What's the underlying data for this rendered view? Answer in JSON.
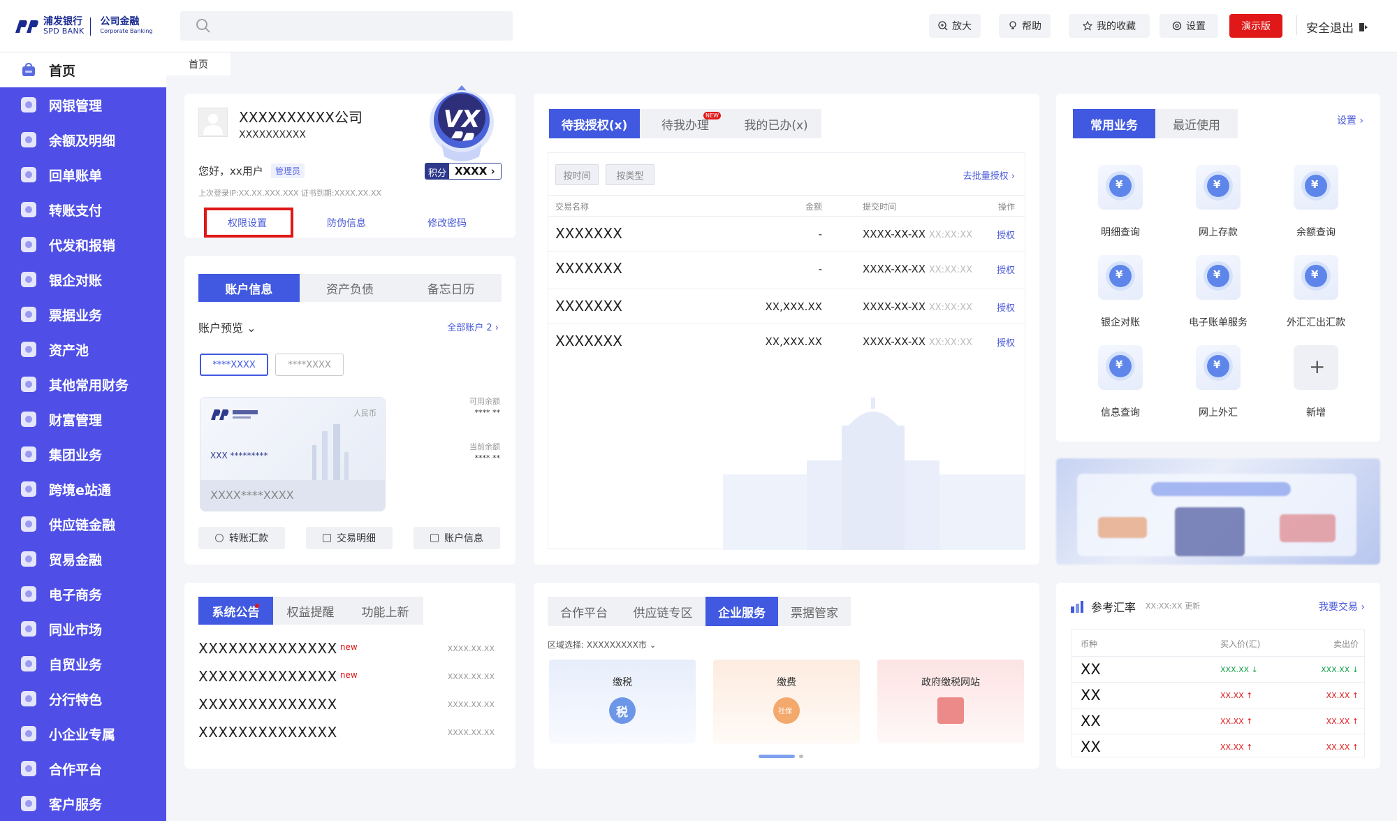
{
  "brand": {
    "cn": "浦发银行",
    "en": "SPD BANK",
    "corp_cn": "公司金融",
    "corp_en": "Corporate Banking"
  },
  "header": {
    "search_placeholder": "",
    "buttons": [
      {
        "label": "放大",
        "icon": "zoom-in-icon"
      },
      {
        "label": "帮助",
        "icon": "bulb-icon"
      },
      {
        "label": "我的收藏",
        "icon": "star-icon"
      },
      {
        "label": "设置",
        "icon": "gear-icon"
      }
    ],
    "demo_label": "演示版",
    "logout_label": "安全退出",
    "demo_color": "#e01818"
  },
  "sidebar": {
    "home_label": "首页",
    "items": [
      "网银管理",
      "余额及明细",
      "回单账单",
      "转账支付",
      "代发和报销",
      "银企对账",
      "票据业务",
      "资产池",
      "其他常用财务",
      "财富管理",
      "集团业务",
      "跨境e站通",
      "供应链金融",
      "贸易金融",
      "电子商务",
      "同业市场",
      "自贸业务",
      "分行特色",
      "小企业专属",
      "合作平台",
      "客户服务"
    ],
    "accent_color": "#4f4fe8"
  },
  "breadcrumb": {
    "label": "首页"
  },
  "company": {
    "name": "XXXXXXXXXX公司",
    "sub": "XXXXXXXXXX",
    "greeting": "您好，xx用户",
    "role": "管理员",
    "login_info": "上次登录IP:XX.XX.XXX.XXX    证书到期:XXXX.XX.XX",
    "links": [
      "权限设置",
      "防伪信息",
      "修改密码"
    ],
    "score_label": "积分",
    "score_value": "XXXX ›",
    "vip_label": "VX"
  },
  "account": {
    "tabs": [
      "账户信息",
      "资产负债",
      "备忘日历"
    ],
    "preview_label": "账户预览 ⌄",
    "all_accounts": "全部账户 2 ›",
    "chips": [
      "****XXXX",
      "****XXXX"
    ],
    "card_currency": "人民币",
    "card_number": "XXX *********",
    "card_footer": "XXXX****XXXX",
    "avail_label": "可用余额",
    "avail_value": "**** **",
    "current_label": "当前余额",
    "current_value": "**** **",
    "actions": [
      "转账汇款",
      "交易明细",
      "账户信息"
    ]
  },
  "approval": {
    "tabs": [
      "待我授权(x)",
      "待我办理",
      "我的已办(x)"
    ],
    "new_badge": "NEW",
    "filters": [
      "按时间",
      "按类型"
    ],
    "batch_link": "去批量授权 ›",
    "columns": [
      "交易名称",
      "金额",
      "提交时间",
      "操作"
    ],
    "rows": [
      {
        "name": "XXXXXXX",
        "amount": "-",
        "date": "XXXX-XX-XX",
        "time": "XX:XX:XX",
        "op": "授权"
      },
      {
        "name": "XXXXXXX",
        "amount": "-",
        "date": "XXXX-XX-XX",
        "time": "XX:XX:XX",
        "op": "授权"
      },
      {
        "name": "XXXXXXX",
        "amount": "XX,XXX.XX",
        "date": "XXXX-XX-XX",
        "time": "XX:XX:XX",
        "op": "授权"
      },
      {
        "name": "XXXXXXX",
        "amount": "XX,XXX.XX",
        "date": "XXXX-XX-XX",
        "time": "XX:XX:XX",
        "op": "授权"
      }
    ]
  },
  "common": {
    "tabs": [
      "常用业务",
      "最近使用"
    ],
    "settings_link": "设置 ›",
    "services": [
      "明细查询",
      "网上存款",
      "余额查询",
      "银企对账",
      "电子账单服务",
      "外汇汇出汇款",
      "信息查询",
      "网上外汇",
      "新增"
    ]
  },
  "notice": {
    "tabs": [
      "系统公告",
      "权益提醒",
      "功能上新"
    ],
    "rows": [
      {
        "title": "XXXXXXXXXXXXXX",
        "new": "new",
        "date": "XXXX.XX.XX"
      },
      {
        "title": "XXXXXXXXXXXXXX",
        "new": "new",
        "date": "XXXX.XX.XX"
      },
      {
        "title": "XXXXXXXXXXXXXX",
        "new": "",
        "date": "XXXX.XX.XX"
      },
      {
        "title": "XXXXXXXXXXXXXX",
        "new": "",
        "date": "XXXX.XX.XX"
      }
    ]
  },
  "partner": {
    "tabs": [
      "合作平台",
      "供应链专区",
      "企业服务",
      "票据管家"
    ],
    "region": "区域选择:  XXXXXXXXX市 ⌄",
    "tiles": [
      {
        "label": "缴税",
        "icon": "tax-icon",
        "badge": "税"
      },
      {
        "label": "缴费",
        "icon": "social-security-icon",
        "badge": "社保"
      },
      {
        "label": "政府缴税网站",
        "icon": "government-building-icon",
        "badge": ""
      }
    ]
  },
  "fx": {
    "title": "参考汇率",
    "updated": "XX:XX:XX 更新",
    "trade_link": "我要交易 ›",
    "columns": [
      "币种",
      "买入价(汇)",
      "卖出价"
    ],
    "rows": [
      {
        "cur": "XX",
        "buy": "XXX.XX ↓",
        "sell": "XXX.XX ↓",
        "dir": "down"
      },
      {
        "cur": "XX",
        "buy": "XX.XX ↑",
        "sell": "XX.XX ↑",
        "dir": "up"
      },
      {
        "cur": "XX",
        "buy": "XX.XX ↑",
        "sell": "XX.XX ↑",
        "dir": "up"
      },
      {
        "cur": "XX",
        "buy": "XX.XX ↑",
        "sell": "XX.XX ↑",
        "dir": "up"
      }
    ]
  }
}
